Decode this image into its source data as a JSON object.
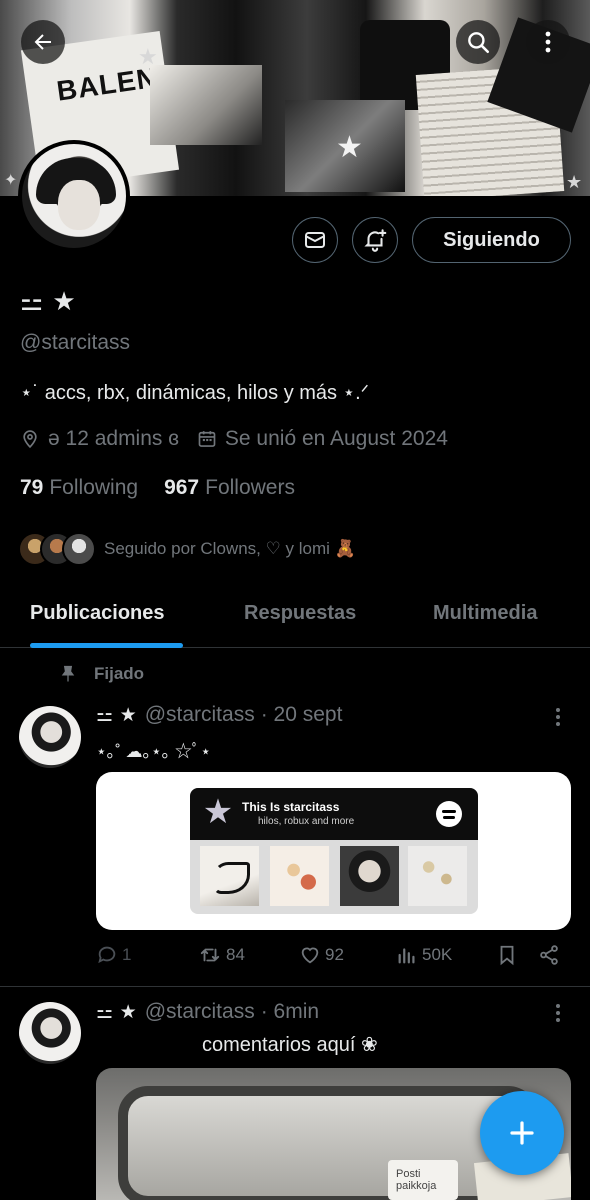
{
  "profile": {
    "name": "⚍ ★",
    "handle": "@starcitass",
    "bio": "⋆˙ accs, rbx, dinámicas, hilos y más ⋆.ᐟ",
    "location": "ə 12 admins ɞ",
    "joined": "Se unió en August 2024",
    "following_count": "79",
    "following_label": "Following",
    "followers_count": "967",
    "followers_label": "Followers",
    "followed_by": "Seguido por Clowns, ♡ y lomi 🧸",
    "follow_button": "Siguiendo"
  },
  "banner": {
    "brand_text": "BALEN"
  },
  "tabs": [
    {
      "label": "Publicaciones",
      "active": true
    },
    {
      "label": "Respuestas",
      "active": false
    },
    {
      "label": "Multimedia",
      "active": false
    }
  ],
  "pinned_label": "Fijado",
  "posts": [
    {
      "name": "⚍ ★",
      "handle": "@starcitass",
      "time": "· 20 sept",
      "text": "⋆｡˚ ☁︎｡⋆｡ ☆ﾟ⋆",
      "card": {
        "title": "This Is starcitass",
        "subtitle": "hilos, robux and more"
      },
      "stats": {
        "replies": "1",
        "reposts": "84",
        "likes": "92",
        "views": "50K"
      }
    },
    {
      "name": "⚍ ★",
      "handle": "@starcitass",
      "time": "· 6min",
      "text": "comentarios aquí ❀",
      "photo": {
        "sign_text": "Posti paikkoja"
      }
    }
  ],
  "colors": {
    "accent": "#1d9bf0",
    "muted": "#71767b",
    "text": "#e7e9ea",
    "border": "#2f3336",
    "background": "#000000"
  }
}
